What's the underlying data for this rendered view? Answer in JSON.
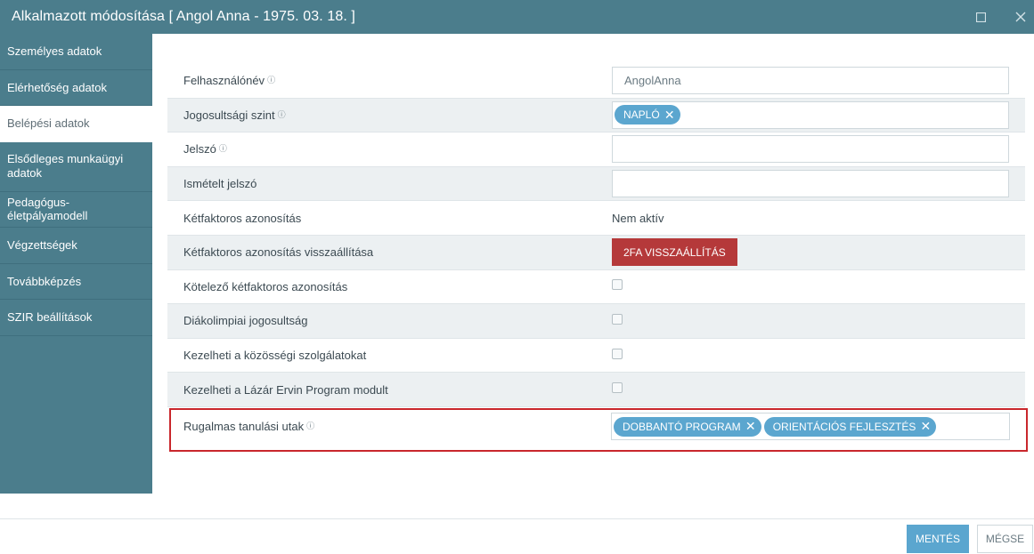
{
  "window": {
    "title": "Alkalmazott módosítása [ Angol Anna - 1975. 03. 18. ]",
    "maximize_icon": "maximize-icon",
    "close_icon": "close-icon"
  },
  "sidebar": {
    "items": [
      {
        "label": "Személyes adatok",
        "active": false
      },
      {
        "label": "Elérhetőség adatok",
        "active": false
      },
      {
        "label": "Belépési adatok",
        "active": true
      },
      {
        "label": "Elsődleges munkaügyi adatok",
        "active": false
      },
      {
        "label": "Pedagógus-életpályamodell",
        "active": false
      },
      {
        "label": "Végzettségek",
        "active": false
      },
      {
        "label": "Továbbképzés",
        "active": false
      },
      {
        "label": "SZIR beállítások",
        "active": false
      }
    ]
  },
  "form": {
    "username": {
      "label": "Felhasználónév",
      "value": "AngolAnna"
    },
    "access_level": {
      "label": "Jogosultsági szint",
      "tags": [
        "NAPLÓ"
      ]
    },
    "password": {
      "label": "Jelszó",
      "value": ""
    },
    "password_repeat": {
      "label": "Ismételt jelszó",
      "value": ""
    },
    "two_factor": {
      "label": "Kétfaktoros azonosítás",
      "value": "Nem aktív"
    },
    "two_factor_reset": {
      "label": "Kétfaktoros azonosítás visszaállítása",
      "button": "2FA VISSZAÁLLÍTÁS"
    },
    "two_factor_required": {
      "label": "Kötelező kétfaktoros azonosítás",
      "checked": false
    },
    "student_olympics": {
      "label": "Diákolimpiai jogosultság",
      "checked": false
    },
    "community_service": {
      "label": "Kezelheti a közösségi szolgálatokat",
      "checked": false
    },
    "lazar_ervin": {
      "label": "Kezelheti a Lázár Ervin Program modult",
      "checked": false
    },
    "flexible_paths": {
      "label": "Rugalmas tanulási utak",
      "tags": [
        "DOBBANTÓ PROGRAM",
        "ORIENTÁCIÓS FEJLESZTÉS"
      ]
    }
  },
  "footer": {
    "save_label": "MENTÉS",
    "cancel_label": "MÉGSE"
  },
  "colors": {
    "header": "#4b7d8c",
    "tag": "#5ba6cf",
    "danger_button": "#b5393a",
    "highlight_border": "#c9272c",
    "save_button": "#5ba6cf"
  }
}
